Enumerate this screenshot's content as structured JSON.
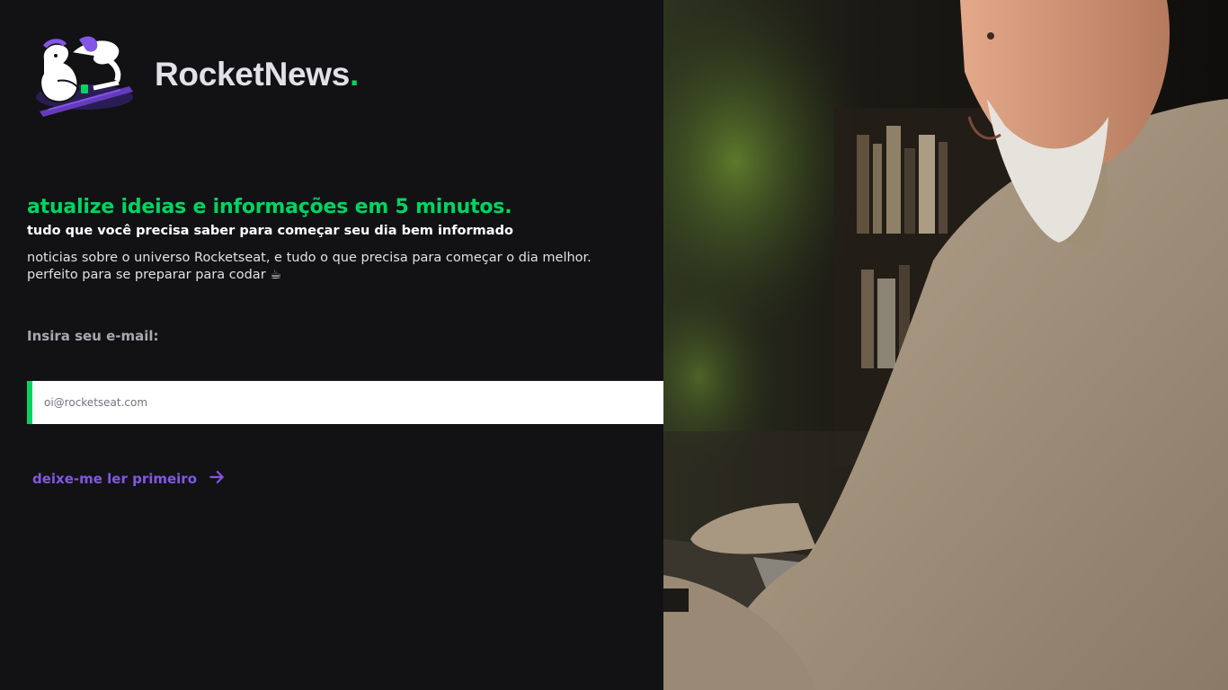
{
  "brand": {
    "name": "RocketNews",
    "dot": "."
  },
  "hero": {
    "headline": "atualize ideias e informações em 5 minutos.",
    "subheadline": "tudo que você precisa saber para começar seu dia bem informado",
    "description_line1": "noticias sobre o universo Rocketseat, e tudo o que precisa para começar o dia melhor.",
    "description_line2": "perfeito para se preparar para codar ☕"
  },
  "form": {
    "label": "Insira seu e-mail:",
    "placeholder": "oi@rocketseat.com",
    "value": "",
    "submit_icon": "send-icon"
  },
  "read_first": {
    "label": "deixe-me ler primeiro",
    "icon": "arrow-right-icon"
  },
  "colors": {
    "background": "#121214",
    "accent_green": "#04d361",
    "accent_purple": "#8257e5",
    "text_light": "#e1e1e6",
    "text_muted": "#a8a8b3"
  }
}
